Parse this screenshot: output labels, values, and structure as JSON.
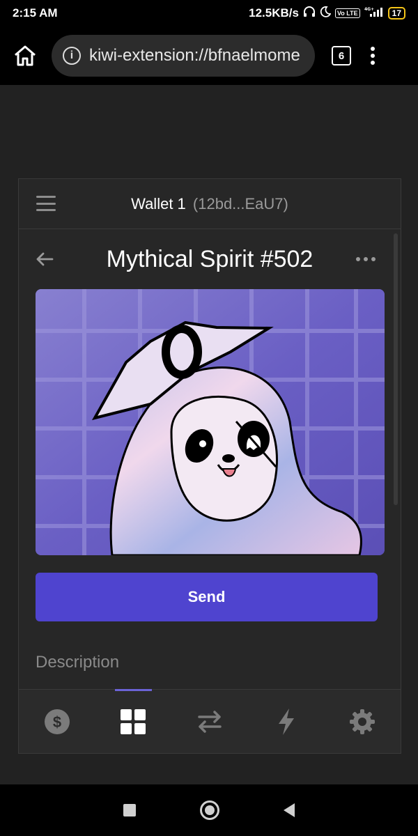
{
  "status_bar": {
    "time": "2:15 AM",
    "net_speed": "12.5KB/s",
    "headphones_icon": "headphones-icon",
    "moon_icon": "moon-icon",
    "volte": "Vo LTE",
    "network": "4G+",
    "battery": "17"
  },
  "browser": {
    "url": "kiwi-extension://bfnaelmome",
    "tab_count": "6"
  },
  "wallet": {
    "name": "Wallet 1",
    "address": "(12bd...EaU7)"
  },
  "nft": {
    "title": "Mythical Spirit #502",
    "send_label": "Send",
    "description_label": "Description"
  },
  "bottom_nav": {
    "items": [
      {
        "icon": "dollar-icon",
        "active": false
      },
      {
        "icon": "grid-icon",
        "active": true
      },
      {
        "icon": "swap-icon",
        "active": false
      },
      {
        "icon": "lightning-icon",
        "active": false
      },
      {
        "icon": "gear-icon",
        "active": false
      }
    ]
  },
  "colors": {
    "accent": "#4f44cf",
    "active_indicator": "#6b63d6",
    "background": "#222222",
    "panel": "#272727"
  }
}
